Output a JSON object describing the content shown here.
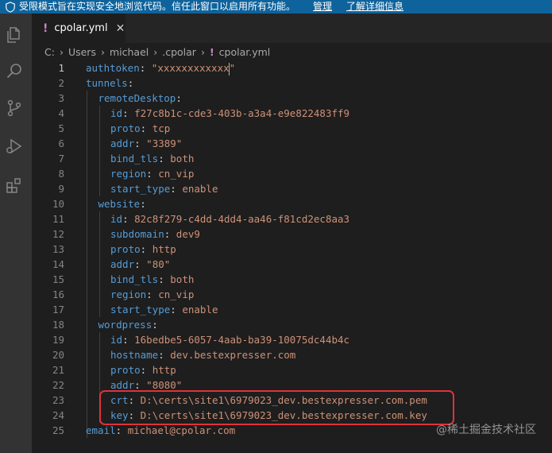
{
  "banner": {
    "message": "受限模式旨在实现安全地浏览代码。信任此窗口以启用所有功能。",
    "manage_label": "管理",
    "learn_more_label": "了解详细信息"
  },
  "tab": {
    "icon": "!",
    "title": "cpolar.yml",
    "close": "✕"
  },
  "breadcrumb": {
    "parts": [
      "C:",
      "Users",
      "michael",
      ".cpolar"
    ],
    "file_icon": "!",
    "file": "cpolar.yml"
  },
  "editor": {
    "lines": [
      {
        "n": "1",
        "indent": 0,
        "key": "authtoken",
        "value": "\"xxxxxxxxxxxx\""
      },
      {
        "n": "2",
        "indent": 0,
        "key": "tunnels",
        "value": ""
      },
      {
        "n": "3",
        "indent": 1,
        "key": "remoteDesktop",
        "value": ""
      },
      {
        "n": "4",
        "indent": 2,
        "key": "id",
        "value": "f27c8b1c-cde3-403b-a3a4-e9e822483ff9"
      },
      {
        "n": "5",
        "indent": 2,
        "key": "proto",
        "value": "tcp"
      },
      {
        "n": "6",
        "indent": 2,
        "key": "addr",
        "value": "\"3389\""
      },
      {
        "n": "7",
        "indent": 2,
        "key": "bind_tls",
        "value": "both"
      },
      {
        "n": "8",
        "indent": 2,
        "key": "region",
        "value": "cn_vip"
      },
      {
        "n": "9",
        "indent": 2,
        "key": "start_type",
        "value": "enable"
      },
      {
        "n": "10",
        "indent": 1,
        "key": "website",
        "value": ""
      },
      {
        "n": "11",
        "indent": 2,
        "key": "id",
        "value": "82c8f279-c4dd-4dd4-aa46-f81cd2ec8aa3"
      },
      {
        "n": "12",
        "indent": 2,
        "key": "subdomain",
        "value": "dev9"
      },
      {
        "n": "13",
        "indent": 2,
        "key": "proto",
        "value": "http"
      },
      {
        "n": "14",
        "indent": 2,
        "key": "addr",
        "value": "\"80\""
      },
      {
        "n": "15",
        "indent": 2,
        "key": "bind_tls",
        "value": "both"
      },
      {
        "n": "16",
        "indent": 2,
        "key": "region",
        "value": "cn_vip"
      },
      {
        "n": "17",
        "indent": 2,
        "key": "start_type",
        "value": "enable"
      },
      {
        "n": "18",
        "indent": 1,
        "key": "wordpress",
        "value": ""
      },
      {
        "n": "19",
        "indent": 2,
        "key": "id",
        "value": "16bedbe5-6057-4aab-ba39-10075dc44b4c"
      },
      {
        "n": "20",
        "indent": 2,
        "key": "hostname",
        "value": "dev.bestexpresser.com"
      },
      {
        "n": "21",
        "indent": 2,
        "key": "proto",
        "value": "http"
      },
      {
        "n": "22",
        "indent": 2,
        "key": "addr",
        "value": "\"8080\""
      },
      {
        "n": "23",
        "indent": 2,
        "key": "crt",
        "value": "D:\\certs\\site1\\6979023_dev.bestexpresser.com.pem"
      },
      {
        "n": "24",
        "indent": 2,
        "key": "key",
        "value": "D:\\certs\\site1\\6979023_dev.bestexpresser.com.key"
      },
      {
        "n": "25",
        "indent": 0,
        "key": "email",
        "value": "michael@cpolar.com"
      }
    ]
  },
  "watermark": "@稀土掘金技术社区",
  "colors": {
    "banner": "#0e639c",
    "key": "#569cd6",
    "value": "#ce9178",
    "highlight_box": "#e0323a"
  }
}
